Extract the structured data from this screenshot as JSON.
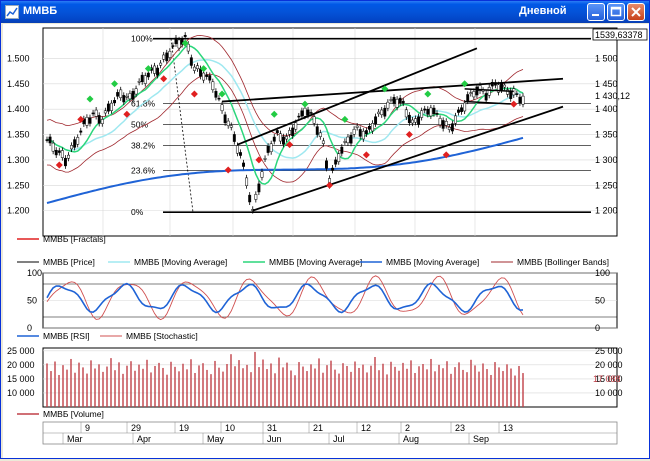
{
  "window": {
    "title": "ММВБ",
    "period": "Дневной",
    "last_price_box": "1539,63378"
  },
  "colors": {
    "titlebar": "#0453D8",
    "price": "#000000",
    "ma_short": "#2BD67B",
    "ma_mid": "#9FE8F0",
    "ma_long": "#1F63D6",
    "bollinger": "#A0282E",
    "fractal_up": "#22CC44",
    "fractal_down": "#E02020",
    "rsi": "#1F63D6",
    "stochastic": "#D05050",
    "volume": "#C04048"
  },
  "icons": [
    "chart-app-icon",
    "minimize-icon",
    "maximize-icon",
    "close-icon",
    "legend-line-icon"
  ],
  "chart_data": [
    {
      "type": "line",
      "panel": "price",
      "ylim": [
        1150,
        1560
      ],
      "y_ticks": [
        1200,
        1250,
        1300,
        1350,
        1400,
        1450,
        1500
      ],
      "y_tick_labels_left": [
        "1.200",
        "1.250",
        "1.300",
        "1.350",
        "1.400",
        "1.450",
        "1.500"
      ],
      "y_tick_labels_right": [
        "1 200",
        "1 250",
        "1 300",
        "1 350",
        "1 400",
        "1 450",
        "1 500"
      ],
      "current_value_label": "1 430,12",
      "fib_labels": [
        "100%",
        "61.8%",
        "50%",
        "38.2%",
        "23.6%",
        "0%"
      ],
      "fib_levels": [
        1539,
        1411,
        1370,
        1328,
        1279,
        1197
      ],
      "price_path": [
        [
          0,
          1340
        ],
        [
          3,
          1320
        ],
        [
          6,
          1300
        ],
        [
          9,
          1330
        ],
        [
          12,
          1370
        ],
        [
          15,
          1390
        ],
        [
          18,
          1380
        ],
        [
          21,
          1410
        ],
        [
          24,
          1430
        ],
        [
          27,
          1420
        ],
        [
          30,
          1450
        ],
        [
          33,
          1470
        ],
        [
          36,
          1480
        ],
        [
          39,
          1505
        ],
        [
          42,
          1530
        ],
        [
          45,
          1539
        ],
        [
          48,
          1480
        ],
        [
          51,
          1470
        ],
        [
          54,
          1450
        ],
        [
          57,
          1400
        ],
        [
          60,
          1360
        ],
        [
          63,
          1310
        ],
        [
          65,
          1260
        ],
        [
          67,
          1197
        ],
        [
          69,
          1250
        ],
        [
          72,
          1320
        ],
        [
          75,
          1350
        ],
        [
          78,
          1340
        ],
        [
          81,
          1370
        ],
        [
          84,
          1400
        ],
        [
          87,
          1380
        ],
        [
          90,
          1330
        ],
        [
          92,
          1260
        ],
        [
          95,
          1310
        ],
        [
          98,
          1340
        ],
        [
          101,
          1360
        ],
        [
          104,
          1350
        ],
        [
          107,
          1380
        ],
        [
          110,
          1400
        ],
        [
          113,
          1420
        ],
        [
          116,
          1410
        ],
        [
          119,
          1370
        ],
        [
          122,
          1390
        ],
        [
          125,
          1400
        ],
        [
          128,
          1380
        ],
        [
          131,
          1360
        ],
        [
          134,
          1390
        ],
        [
          137,
          1420
        ],
        [
          140,
          1440
        ],
        [
          143,
          1430
        ],
        [
          146,
          1450
        ],
        [
          149,
          1440
        ],
        [
          152,
          1430
        ],
        [
          155,
          1420
        ]
      ],
      "fractals_up": [
        [
          14,
          1420
        ],
        [
          22,
          1450
        ],
        [
          33,
          1480
        ],
        [
          45,
          1530
        ],
        [
          51,
          1480
        ],
        [
          57,
          1430
        ],
        [
          74,
          1390
        ],
        [
          84,
          1410
        ],
        [
          97,
          1380
        ],
        [
          110,
          1440
        ],
        [
          124,
          1430
        ],
        [
          136,
          1450
        ]
      ],
      "fractals_down": [
        [
          4,
          1290
        ],
        [
          11,
          1380
        ],
        [
          26,
          1390
        ],
        [
          38,
          1460
        ],
        [
          48,
          1430
        ],
        [
          59,
          1280
        ],
        [
          69,
          1300
        ],
        [
          79,
          1330
        ],
        [
          92,
          1250
        ],
        [
          104,
          1310
        ],
        [
          118,
          1350
        ],
        [
          130,
          1310
        ],
        [
          152,
          1410
        ]
      ],
      "legend": [
        "ММВБ [Fractals]",
        "ММВБ [Price]",
        "ММВБ [Moving Average]",
        "ММВБ [Moving Average]",
        "ММВБ [Moving Average]",
        "ММВБ [Bollinger Bands]"
      ]
    },
    {
      "type": "line",
      "panel": "oscillator",
      "ylim": [
        0,
        100
      ],
      "y_ticks": [
        0,
        50,
        100
      ],
      "y_tick_labels": [
        "0",
        "50",
        "100"
      ],
      "legend": [
        "ММВБ [RSI]",
        "ММВБ [Stochastic]"
      ]
    },
    {
      "type": "bar",
      "panel": "volume",
      "ylim": [
        5000,
        26000
      ],
      "y_ticks": [
        10000,
        15000,
        20000,
        25000
      ],
      "y_tick_labels_left": [
        "10 000",
        "15 000",
        "20 000",
        "25 000"
      ],
      "y_tick_labels_right": [
        "10 000",
        "15 000",
        "20 000",
        "25 000"
      ],
      "current_value_label": "17 088",
      "values": [
        20500,
        17800,
        21200,
        16400,
        19900,
        18300,
        22100,
        17200,
        20800,
        19100,
        16900,
        21600,
        18700,
        20200,
        17500,
        19400,
        22400,
        18100,
        20900,
        16800,
        19700,
        21300,
        17900,
        20100,
        18600,
        21800,
        17300,
        19600,
        20700,
        18900,
        16500,
        21100,
        19300,
        17700,
        20400,
        18400,
        22000,
        17100,
        19800,
        20600,
        18200,
        16700,
        21400,
        19000,
        17600,
        20300,
        23800,
        19500,
        21700,
        18800,
        20000,
        17400,
        24600,
        19200,
        21900,
        18500,
        20500,
        17000,
        22600,
        19100,
        20800,
        18000,
        16300,
        21000,
        19400,
        17800,
        20200,
        18700,
        22300,
        17200,
        19900,
        21500,
        18300,
        16900,
        20600,
        19600,
        17500,
        21200,
        18900,
        20100,
        17300,
        19700,
        22800,
        18100,
        20400,
        16600,
        21100,
        19300,
        17900,
        20700,
        18600,
        21600,
        17100,
        19500,
        20300,
        18400,
        22100,
        17700,
        20000,
        18800,
        21300,
        16800,
        19200,
        20900,
        18200,
        17400,
        21800,
        19800,
        17600,
        20500,
        18500,
        16400,
        21000,
        19100,
        17800,
        20200,
        18700,
        16200,
        19600,
        17088
      ],
      "legend": [
        "ММВБ [Volume]"
      ]
    }
  ],
  "time_axis": {
    "days": [
      "9",
      "29",
      "19",
      "10",
      "31",
      "21",
      "12",
      "2",
      "23",
      "13"
    ],
    "months": [
      "Mar",
      "Apr",
      "May",
      "Jun",
      "Jul",
      "Aug",
      "Sep"
    ]
  }
}
